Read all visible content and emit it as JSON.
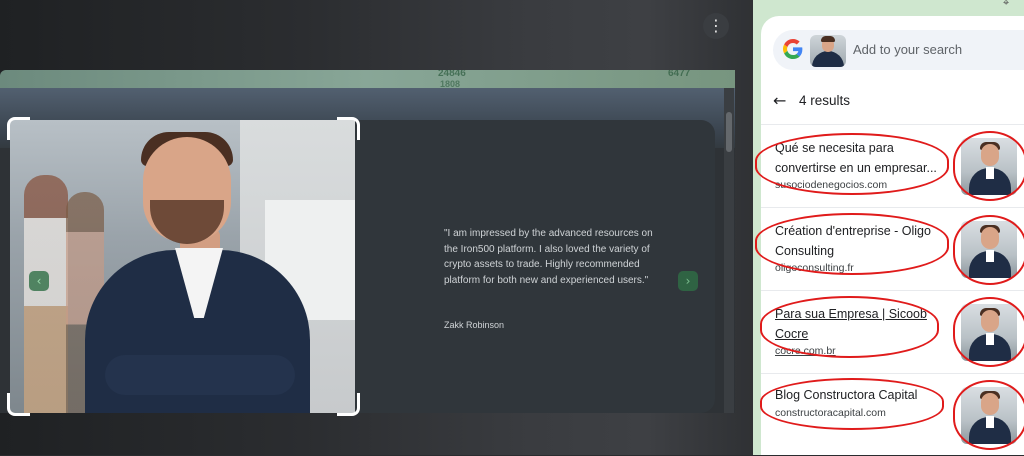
{
  "viewer": {
    "menu_icon": "⋮"
  },
  "captured_page": {
    "ghost_numbers": [
      "24846",
      "1808",
      "6477"
    ],
    "testimonial_quote": "\"I am impressed by the advanced resources on the Iron500 platform. I also loved the variety of crypto assets to trade. Highly recommended platform for both new and experienced users.\"",
    "testimonial_author": "Zakk Robinson",
    "prev_arrow": "‹",
    "next_arrow": "›"
  },
  "lens_panel": {
    "pin_icon": "⌖",
    "search_placeholder": "Add to your search",
    "back_icon": "←",
    "results_count": "4 results",
    "results": [
      {
        "title": "Qué se necesita para convertirse en un empresar...",
        "source": "susociodenegocios.com",
        "underlined": false
      },
      {
        "title": "Création d'entreprise - Oligo Consulting",
        "source": "oligoconsulting.fr",
        "underlined": false
      },
      {
        "title": "Para sua Empresa | Sicoob Cocre",
        "source": "cocre.com.br",
        "underlined": true
      },
      {
        "title": "Blog Constructora Capital",
        "source": "constructoracapital.com",
        "underlined": false
      }
    ]
  },
  "colors": {
    "annotation_red": "#e01b1b",
    "panel_bg": "#ffffff",
    "accent_green": "#2f6f45"
  }
}
